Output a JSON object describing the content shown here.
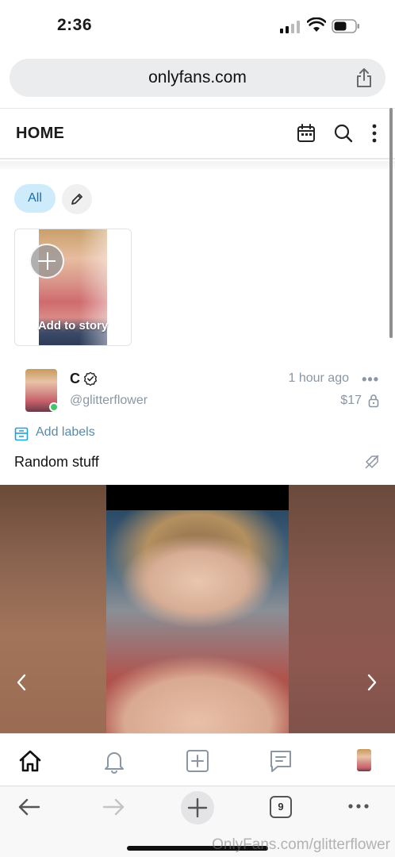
{
  "status_bar": {
    "time": "2:36"
  },
  "browser": {
    "url": "onlyfans.com",
    "tabs_count": "9"
  },
  "header": {
    "title": "HOME"
  },
  "filters": {
    "all_label": "All"
  },
  "story": {
    "add_label": "Add to story"
  },
  "post": {
    "author_name": "C",
    "handle": "@glitterflower",
    "time": "1 hour ago",
    "price": "$17",
    "labels_text": "Add labels",
    "text": "Random stuff"
  },
  "watermark": "OnlyFans.com/glitterflower",
  "colors": {
    "accent": "#00aff0",
    "chip_bg": "#cdebfb",
    "muted": "#8a96a3",
    "online": "#3ec66b"
  }
}
